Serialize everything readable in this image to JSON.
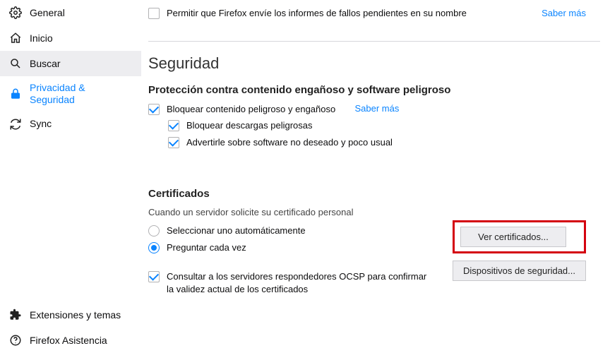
{
  "sidebar": {
    "items": [
      {
        "label": "General"
      },
      {
        "label": "Inicio"
      },
      {
        "label": "Buscar"
      },
      {
        "label": "Privacidad & Seguridad"
      },
      {
        "label": "Sync"
      }
    ],
    "support": {
      "label": "Firefox Asistencia"
    },
    "extensions": {
      "label": "Extensiones y temas"
    }
  },
  "crash": {
    "label": "Permitir que Firefox envíe los informes de fallos pendientes en su nombre",
    "learn_more": "Saber más"
  },
  "security": {
    "heading": "Seguridad",
    "subheading": "Protección contra contenido engañoso y software peligroso",
    "block_dangerous": "Bloquear contenido peligroso y engañoso",
    "learn_more": "Saber más",
    "block_downloads": "Bloquear descargas peligrosas",
    "warn_unwanted": "Advertirle sobre software no deseado y poco usual"
  },
  "certificates": {
    "heading": "Certificados",
    "subtitle": "Cuando un servidor solicite su certificado personal",
    "radio_auto": "Seleccionar uno automáticamente",
    "radio_ask": "Preguntar cada vez",
    "ocsp": "Consultar a los servidores respondedores OCSP para confirmar la validez actual de los certificados",
    "view_btn": "Ver certificados...",
    "devices_btn": "Dispositivos de seguridad..."
  }
}
